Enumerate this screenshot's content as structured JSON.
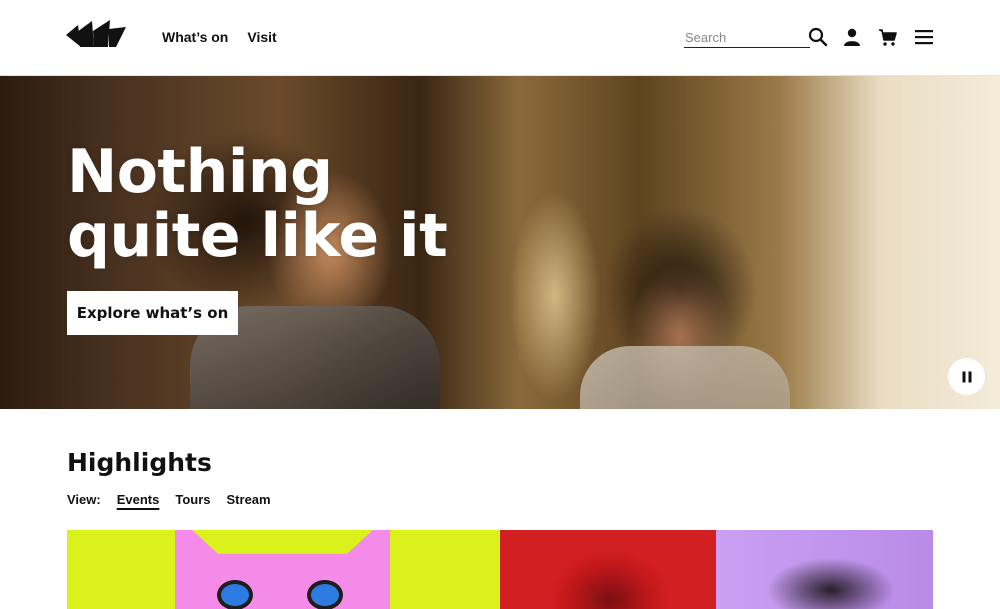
{
  "header": {
    "logo_name": "sydney-opera-house-logo",
    "nav": [
      {
        "label": "What’s on"
      },
      {
        "label": "Visit"
      }
    ],
    "search": {
      "placeholder": "Search",
      "value": ""
    },
    "icons": [
      "search-icon",
      "account-icon",
      "cart-icon",
      "menu-icon"
    ]
  },
  "hero": {
    "title_line1": "Nothing",
    "title_line2": "quite like it",
    "cta_label": "Explore what’s on",
    "pause_icon": "pause-icon"
  },
  "highlights": {
    "title": "Highlights",
    "view_label": "View:",
    "tabs": [
      {
        "label": "Events",
        "active": true
      },
      {
        "label": "Tours",
        "active": false
      },
      {
        "label": "Stream",
        "active": false
      }
    ]
  },
  "colors": {
    "card1_bg": "#dbf11c",
    "card1_cat": "#f58be8",
    "card2_bg": "#c2181b",
    "card3_bg": "#c9a0f2"
  }
}
